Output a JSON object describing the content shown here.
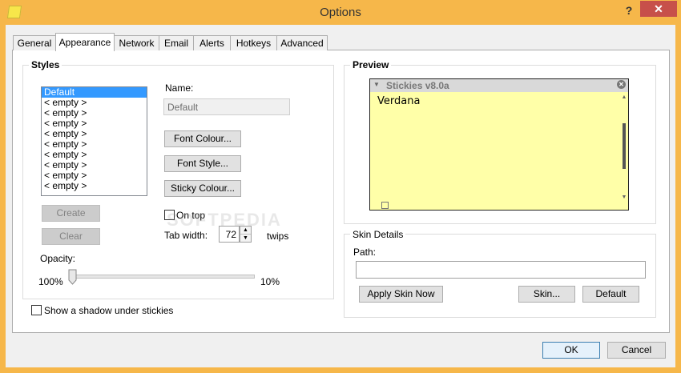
{
  "window": {
    "title": "Options",
    "help_glyph": "?",
    "close_glyph": "✕"
  },
  "tabs": [
    {
      "label": "General",
      "active": false
    },
    {
      "label": "Appearance",
      "active": true
    },
    {
      "label": "Network",
      "active": false
    },
    {
      "label": "Email",
      "active": false
    },
    {
      "label": "Alerts",
      "active": false
    },
    {
      "label": "Hotkeys",
      "active": false
    },
    {
      "label": "Advanced",
      "active": false
    }
  ],
  "styles": {
    "group_title": "Styles",
    "list_items": [
      "Default",
      "< empty >",
      "< empty >",
      "< empty >",
      "< empty >",
      "< empty >",
      "< empty >",
      "< empty >",
      "< empty >",
      "< empty >"
    ],
    "selected_index": 0,
    "create_label": "Create",
    "clear_label": "Clear",
    "name_label": "Name:",
    "name_value": "Default",
    "font_colour_label": "Font Colour...",
    "font_style_label": "Font Style...",
    "sticky_colour_label": "Sticky Colour...",
    "on_top_label": "On top",
    "on_top_checked": false,
    "tab_width_label": "Tab width:",
    "tab_width_value": "72",
    "tab_width_unit": "twips",
    "opacity_label": "Opacity:",
    "opacity_min_label": "100%",
    "opacity_max_label": "10%",
    "opacity_level": 0
  },
  "shadow": {
    "label": "Show a shadow under stickies",
    "checked": false
  },
  "preview": {
    "group_title": "Preview",
    "note_title": "Stickies v8.0a",
    "note_text": "Verdana",
    "note_bg": "#ffffa8"
  },
  "skin": {
    "group_title": "Skin Details",
    "path_label": "Path:",
    "path_value": "",
    "apply_label": "Apply Skin Now",
    "skin_label": "Skin...",
    "default_label": "Default"
  },
  "footer": {
    "ok_label": "OK",
    "cancel_label": "Cancel"
  },
  "watermark": "SOFTPEDIA"
}
